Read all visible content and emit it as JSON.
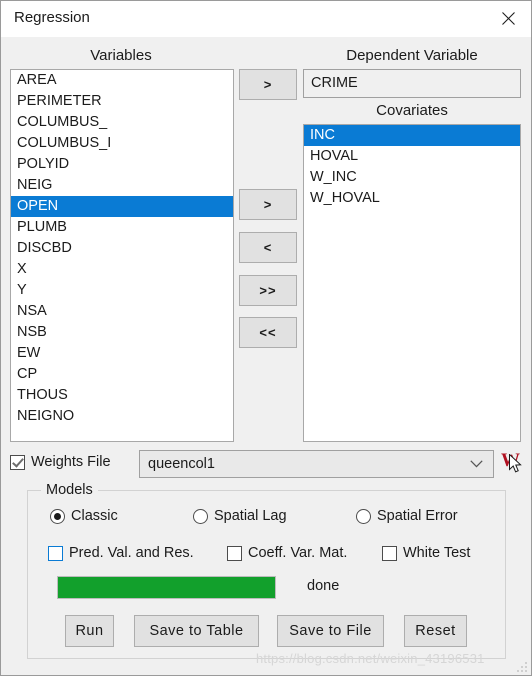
{
  "window": {
    "title": "Regression",
    "close_icon": "close-icon"
  },
  "variables_panel": {
    "heading": "Variables",
    "items": [
      {
        "label": "AREA",
        "selected": false
      },
      {
        "label": "PERIMETER",
        "selected": false
      },
      {
        "label": "COLUMBUS_",
        "selected": false
      },
      {
        "label": "COLUMBUS_I",
        "selected": false
      },
      {
        "label": "POLYID",
        "selected": false
      },
      {
        "label": "NEIG",
        "selected": false
      },
      {
        "label": "OPEN",
        "selected": true
      },
      {
        "label": "PLUMB",
        "selected": false
      },
      {
        "label": "DISCBD",
        "selected": false
      },
      {
        "label": "X",
        "selected": false
      },
      {
        "label": "Y",
        "selected": false
      },
      {
        "label": "NSA",
        "selected": false
      },
      {
        "label": "NSB",
        "selected": false
      },
      {
        "label": "EW",
        "selected": false
      },
      {
        "label": "CP",
        "selected": false
      },
      {
        "label": "THOUS",
        "selected": false
      },
      {
        "label": "NEIGNO",
        "selected": false
      }
    ]
  },
  "transfer_buttons": {
    "dependent_add": ">",
    "covariate_add": ">",
    "covariate_remove": "<",
    "covariate_add_all": ">>",
    "covariate_remove_all": "<<"
  },
  "dependent_variable": {
    "heading": "Dependent Variable",
    "value": "CRIME"
  },
  "covariates": {
    "heading": "Covariates",
    "items": [
      {
        "label": "INC",
        "selected": true
      },
      {
        "label": "HOVAL",
        "selected": false
      },
      {
        "label": "W_INC",
        "selected": false
      },
      {
        "label": "W_HOVAL",
        "selected": false
      }
    ]
  },
  "weights": {
    "checkbox_label": "Weights File",
    "checked": true,
    "selected_file": "queencol1",
    "dropdown_icon": "chevron-down-icon",
    "weights_icon": "w-weights-icon",
    "cursor_icon": "mouse-pointer-icon"
  },
  "models": {
    "legend": "Models",
    "radios": [
      {
        "label": "Classic",
        "checked": true
      },
      {
        "label": "Spatial Lag",
        "checked": false
      },
      {
        "label": "Spatial Error",
        "checked": false
      }
    ],
    "checkboxes": [
      {
        "label": "Pred. Val. and Res.",
        "checked": false,
        "focused": true
      },
      {
        "label": "Coeff. Var. Mat.",
        "checked": false,
        "focused": false
      },
      {
        "label": "White Test",
        "checked": false,
        "focused": false
      }
    ],
    "progress": {
      "percent": 100,
      "status": "done",
      "fill_color": "#12a02c"
    },
    "actions": [
      {
        "label": "Run"
      },
      {
        "label": "Save to Table"
      },
      {
        "label": "Save to File"
      },
      {
        "label": "Reset"
      }
    ]
  },
  "watermark": {
    "text": "https://blog.csdn.net/weixin_43196531"
  },
  "colors": {
    "selection_blue": "#0a7bd4",
    "progress_green": "#12a02c",
    "weights_icon_red": "#b01020",
    "dialog_background": "#f0f0f0"
  }
}
